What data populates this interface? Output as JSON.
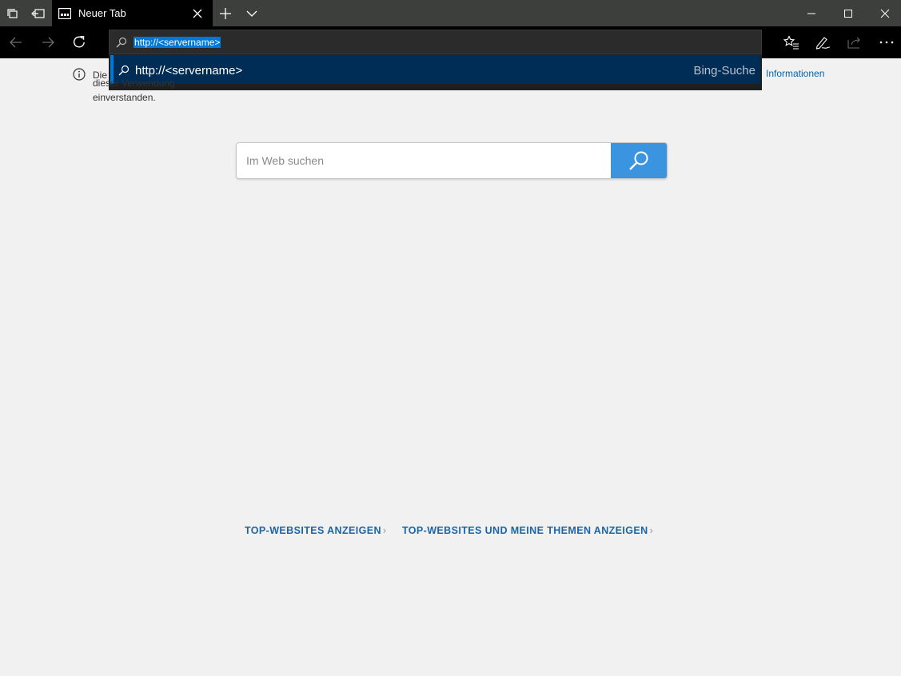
{
  "tab": {
    "title": "Neuer Tab"
  },
  "address": {
    "value": "http://<servername>"
  },
  "suggestion": {
    "text": "http://<servername>",
    "source": "Bing-Suche"
  },
  "notice": {
    "text": "Die",
    "text_line2": "dieser Verwendung einverstanden.",
    "link": "Informationen"
  },
  "search": {
    "placeholder": "Im Web suchen"
  },
  "links": {
    "top_sites": "TOP-WEBSITES ANZEIGEN",
    "top_sites_topics": "TOP-WEBSITES UND MEINE THEMEN ANZEIGEN"
  },
  "colors": {
    "accent": "#0078d7",
    "search_button": "#3a94e0",
    "link": "#1c64a6"
  }
}
